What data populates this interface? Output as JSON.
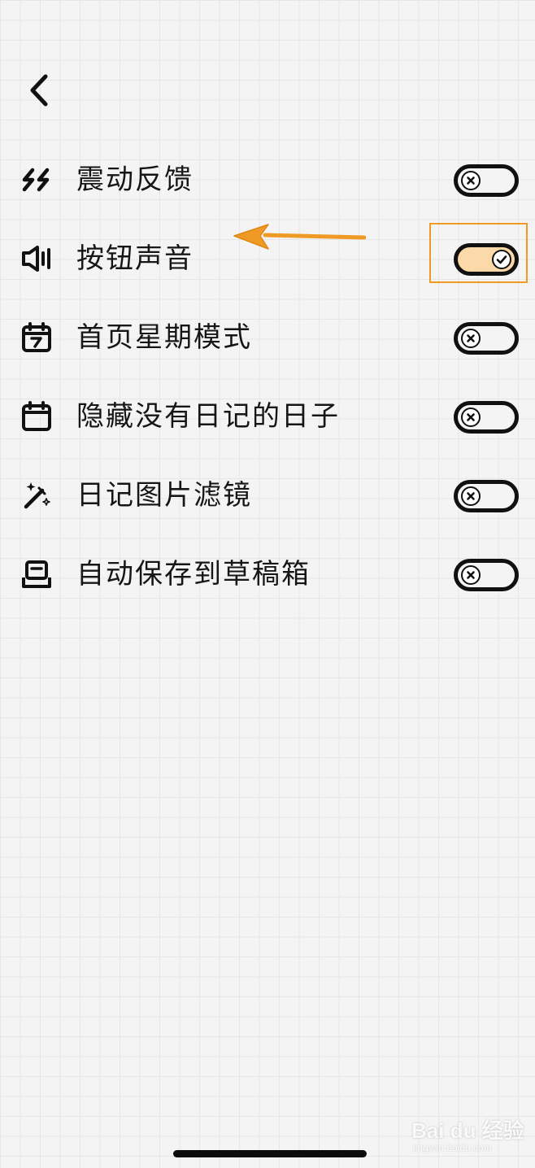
{
  "header": {
    "back_icon": "chevron-left-icon"
  },
  "settings": [
    {
      "label": "震动反馈",
      "icon": "vibration-icon",
      "enabled": false
    },
    {
      "label": "按钮声音",
      "icon": "speaker-icon",
      "enabled": true
    },
    {
      "label": "首页星期模式",
      "icon": "calendar-week-icon",
      "enabled": false
    },
    {
      "label": "隐藏没有日记的日子",
      "icon": "calendar-icon",
      "enabled": false
    },
    {
      "label": "日记图片滤镜",
      "icon": "magic-wand-icon",
      "enabled": false
    },
    {
      "label": "自动保存到草稿箱",
      "icon": "inbox-tray-icon",
      "enabled": false
    }
  ],
  "annotation": {
    "arrow_color": "#f09a26",
    "highlight_color": "#f09a26"
  },
  "colors": {
    "toggle_on_fill": "#fbd9a8",
    "toggle_border": "#111111"
  },
  "watermark": {
    "brand": "Bai du 经验",
    "url": "jingyan.baidu.com"
  }
}
